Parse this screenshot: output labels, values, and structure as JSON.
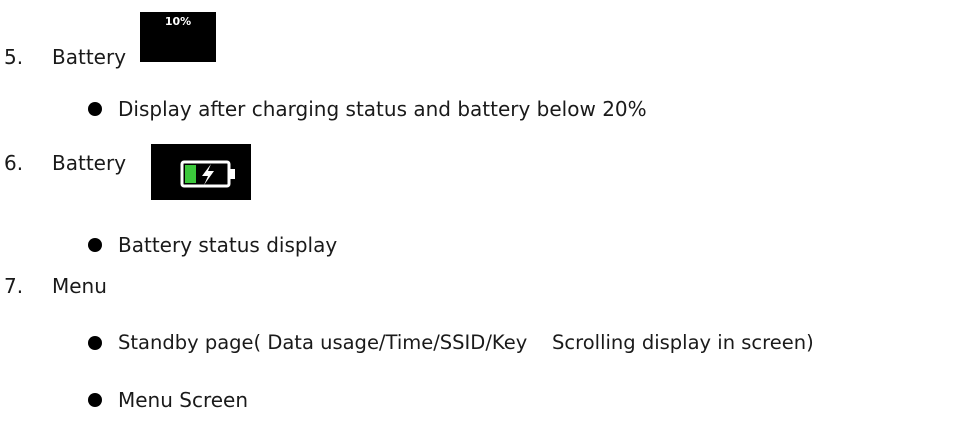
{
  "items": [
    {
      "number": "5.",
      "label": "Battery",
      "icon": "battery-percent-icon",
      "icon_text": "10%",
      "bullets": [
        "Display after charging status and battery below 20%"
      ]
    },
    {
      "number": "6.",
      "label": "Battery",
      "icon": "battery-charging-icon",
      "bullets": [
        "Battery status display"
      ]
    },
    {
      "number": "7.",
      "label": "Menu",
      "bullets": [
        "Standby page( Data usage/Time/SSID/Key    Scrolling display in screen)",
        "Menu Screen"
      ]
    }
  ],
  "colors": {
    "icon_bg": "#000000",
    "battery_fill": "#3cc83c",
    "text": "#1a1a1a"
  }
}
